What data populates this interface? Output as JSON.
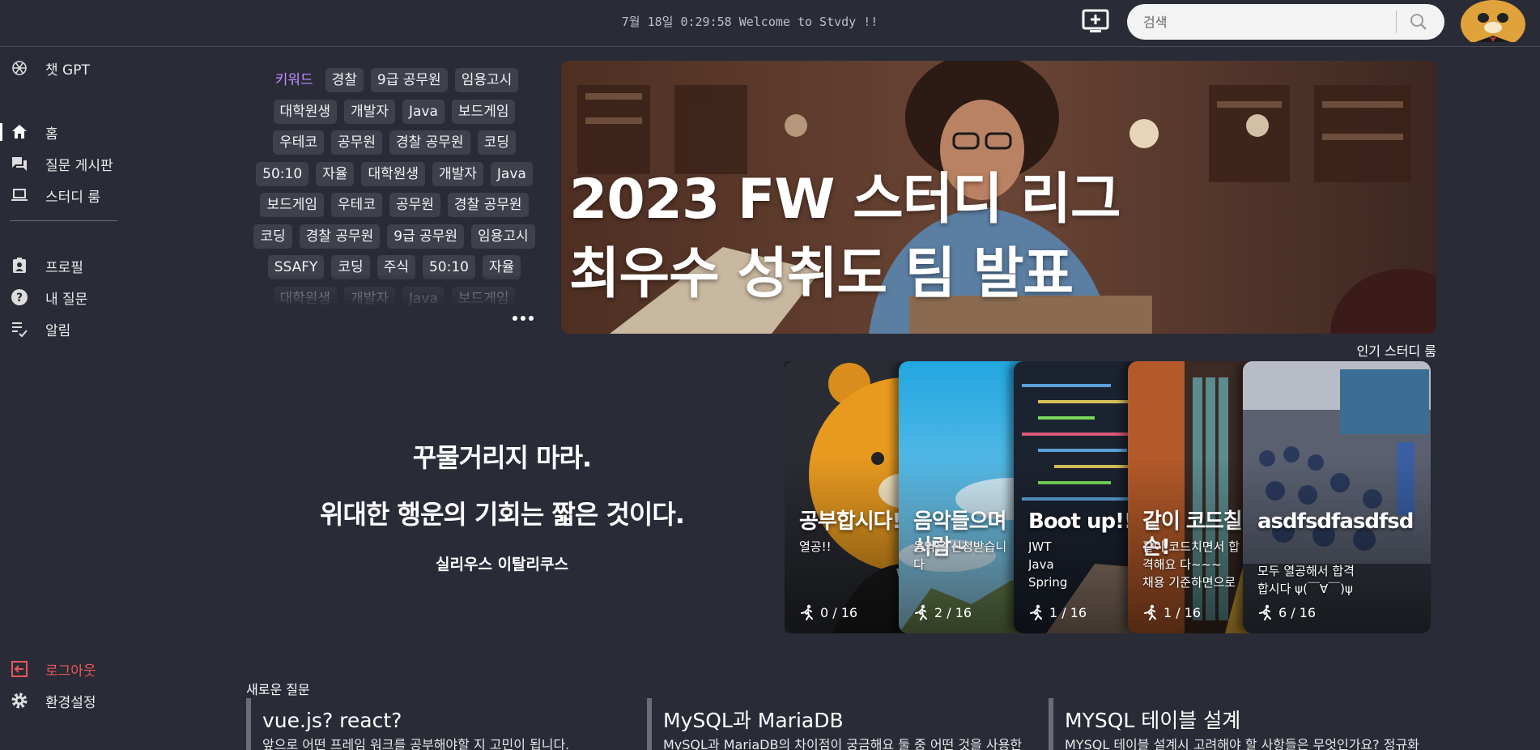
{
  "header": {
    "welcome": "7월 18일 0:29:58 Welcome to Stvdy !!",
    "search_placeholder": "검색",
    "icons": [
      "add-box-icon",
      "search-icon",
      "avatar"
    ]
  },
  "sidebar": {
    "top": {
      "label": "챗 GPT",
      "icon": "openai-icon"
    },
    "main": [
      {
        "label": "홈",
        "icon": "home-icon",
        "active": true
      },
      {
        "label": "질문 게시판",
        "icon": "forum-icon"
      },
      {
        "label": "스터디 룸",
        "icon": "laptop-icon"
      }
    ],
    "user": [
      {
        "label": "프로필",
        "icon": "profile-badge-icon"
      },
      {
        "label": "내 질문",
        "icon": "help-icon"
      },
      {
        "label": "알림",
        "icon": "checklist-icon"
      }
    ],
    "bottom": [
      {
        "label": "로그아웃",
        "icon": "logout-icon"
      },
      {
        "label": "환경설정",
        "icon": "settings-icon"
      }
    ]
  },
  "keywords": {
    "title": "키워드",
    "rows": [
      [
        "경찰",
        "9급 공무원",
        "임용고시"
      ],
      [
        "대학원생",
        "개발자",
        "Java",
        "보드게임"
      ],
      [
        "우테코",
        "공무원",
        "경찰 공무원",
        "코딩"
      ],
      [
        "50:10",
        "자율",
        "대학원생",
        "개발자",
        "Java"
      ],
      [
        "보드게임",
        "우테코",
        "공무원",
        "경찰 공무원"
      ],
      [
        "코딩",
        "경찰 공무원",
        "9급 공무원",
        "임용고시"
      ],
      [
        "SSAFY",
        "코딩",
        "주식",
        "50:10",
        "자율"
      ],
      [
        "대학원생",
        "개발자",
        "Java",
        "보드게임"
      ]
    ]
  },
  "banner": {
    "line1": "2023 FW 스터디 리그",
    "line2": "최우수 성취도 팀 발표"
  },
  "quote": {
    "line1": "꾸물거리지 마라.",
    "line2": "위대한 행운의 기회는 짧은 것이다.",
    "author": "실리우스 이탈리쿠스"
  },
  "popular": {
    "title": "인기 스터디 룸",
    "rooms": [
      {
        "title": "공부합시다!",
        "desc": "열공!!",
        "count": "0 / 16",
        "theme": "bear"
      },
      {
        "title": "음악들으며 사람~",
        "desc": "음악은 신청받습니다",
        "count": "2 / 16",
        "theme": "sky"
      },
      {
        "title": "Boot up!!",
        "desc": "JWT\nJava\nSpring",
        "count": "1 / 16",
        "theme": "code"
      },
      {
        "title": "같이 코드칠 손!",
        "desc": "같이 코드치면서 합격해요 다~~~\n채용 기준하면으로",
        "count": "1 / 16",
        "theme": "books"
      },
      {
        "title": "asdfsdfasdfsd",
        "desc": "모두 열공해서 합격합시다 ψ(￣∀￣)ψ",
        "count": "6 / 16",
        "theme": "class"
      }
    ]
  },
  "new_questions": {
    "title": "새로운 질문",
    "items": [
      {
        "title": "vue.js? react?",
        "desc": "앞으로 어떤 프레임 워크를 공부해야할 지 고민이 됩니다."
      },
      {
        "title": "MySQL과 MariaDB",
        "desc": "MySQL과 MariaDB의 차이점이 궁금해요 둘 중 어떤 것을 사용한"
      },
      {
        "title": "MYSQL 테이블 설계",
        "desc": "MYSQL 테이블 설계시 고려해야 할 사항들은 무엇인가요? 정규화"
      }
    ]
  }
}
